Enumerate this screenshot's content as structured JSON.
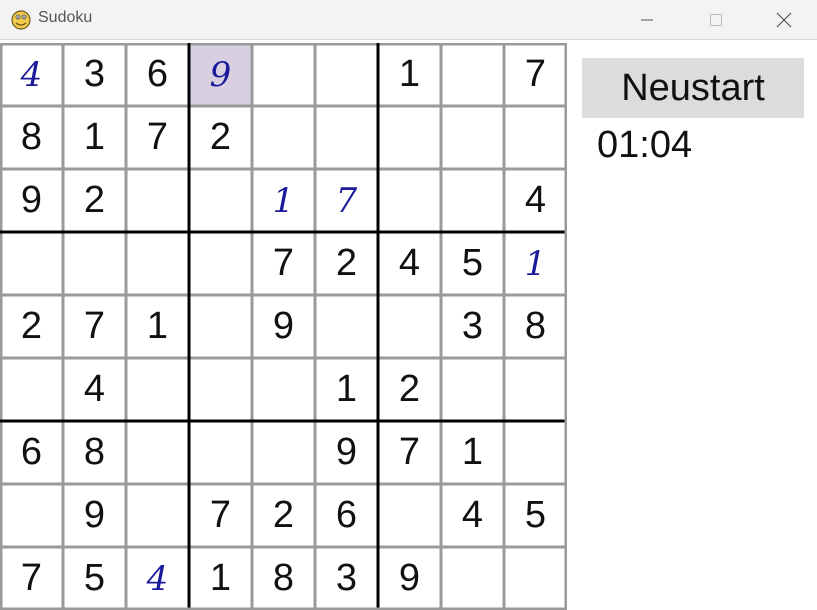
{
  "window": {
    "title": "Sudoku",
    "controls": {
      "minimize_icon": "minimize-icon",
      "maximize_icon": "maximize-icon",
      "close_icon": "close-icon"
    }
  },
  "board": {
    "selected": [
      0,
      3
    ],
    "cells": [
      [
        {
          "v": "4",
          "t": "user"
        },
        {
          "v": "3",
          "t": "given"
        },
        {
          "v": "6",
          "t": "given"
        },
        {
          "v": "9",
          "t": "user"
        },
        {
          "v": "",
          "t": "empty"
        },
        {
          "v": "",
          "t": "empty"
        },
        {
          "v": "1",
          "t": "given"
        },
        {
          "v": "",
          "t": "empty"
        },
        {
          "v": "7",
          "t": "given"
        }
      ],
      [
        {
          "v": "8",
          "t": "given"
        },
        {
          "v": "1",
          "t": "given"
        },
        {
          "v": "7",
          "t": "given"
        },
        {
          "v": "2",
          "t": "given"
        },
        {
          "v": "",
          "t": "empty"
        },
        {
          "v": "",
          "t": "empty"
        },
        {
          "v": "",
          "t": "empty"
        },
        {
          "v": "",
          "t": "empty"
        },
        {
          "v": "",
          "t": "empty"
        }
      ],
      [
        {
          "v": "9",
          "t": "given"
        },
        {
          "v": "2",
          "t": "given"
        },
        {
          "v": "",
          "t": "empty"
        },
        {
          "v": "",
          "t": "empty"
        },
        {
          "v": "1",
          "t": "user"
        },
        {
          "v": "7",
          "t": "user"
        },
        {
          "v": "",
          "t": "empty"
        },
        {
          "v": "",
          "t": "empty"
        },
        {
          "v": "4",
          "t": "given"
        }
      ],
      [
        {
          "v": "",
          "t": "empty"
        },
        {
          "v": "",
          "t": "empty"
        },
        {
          "v": "",
          "t": "empty"
        },
        {
          "v": "",
          "t": "empty"
        },
        {
          "v": "7",
          "t": "given"
        },
        {
          "v": "2",
          "t": "given"
        },
        {
          "v": "4",
          "t": "given"
        },
        {
          "v": "5",
          "t": "given"
        },
        {
          "v": "1",
          "t": "user"
        }
      ],
      [
        {
          "v": "2",
          "t": "given"
        },
        {
          "v": "7",
          "t": "given"
        },
        {
          "v": "1",
          "t": "given"
        },
        {
          "v": "",
          "t": "empty"
        },
        {
          "v": "9",
          "t": "given"
        },
        {
          "v": "",
          "t": "empty"
        },
        {
          "v": "",
          "t": "empty"
        },
        {
          "v": "3",
          "t": "given"
        },
        {
          "v": "8",
          "t": "given"
        }
      ],
      [
        {
          "v": "",
          "t": "empty"
        },
        {
          "v": "4",
          "t": "given"
        },
        {
          "v": "",
          "t": "empty"
        },
        {
          "v": "",
          "t": "empty"
        },
        {
          "v": "",
          "t": "empty"
        },
        {
          "v": "1",
          "t": "given"
        },
        {
          "v": "2",
          "t": "given"
        },
        {
          "v": "",
          "t": "empty"
        },
        {
          "v": "",
          "t": "empty"
        }
      ],
      [
        {
          "v": "6",
          "t": "given"
        },
        {
          "v": "8",
          "t": "given"
        },
        {
          "v": "",
          "t": "empty"
        },
        {
          "v": "",
          "t": "empty"
        },
        {
          "v": "",
          "t": "empty"
        },
        {
          "v": "9",
          "t": "given"
        },
        {
          "v": "7",
          "t": "given"
        },
        {
          "v": "1",
          "t": "given"
        },
        {
          "v": "",
          "t": "empty"
        }
      ],
      [
        {
          "v": "",
          "t": "empty"
        },
        {
          "v": "9",
          "t": "given"
        },
        {
          "v": "",
          "t": "empty"
        },
        {
          "v": "7",
          "t": "given"
        },
        {
          "v": "2",
          "t": "given"
        },
        {
          "v": "6",
          "t": "given"
        },
        {
          "v": "",
          "t": "empty"
        },
        {
          "v": "4",
          "t": "given"
        },
        {
          "v": "5",
          "t": "given"
        }
      ],
      [
        {
          "v": "7",
          "t": "given"
        },
        {
          "v": "5",
          "t": "given"
        },
        {
          "v": "4",
          "t": "user"
        },
        {
          "v": "1",
          "t": "given"
        },
        {
          "v": "8",
          "t": "given"
        },
        {
          "v": "3",
          "t": "given"
        },
        {
          "v": "9",
          "t": "given"
        },
        {
          "v": "",
          "t": "empty"
        },
        {
          "v": "",
          "t": "empty"
        }
      ]
    ]
  },
  "panel": {
    "restart_label": "Neustart",
    "timer": "01:04"
  },
  "colors": {
    "given_digit": "#111111",
    "user_digit": "#1a1a9a",
    "selected_cell": "#d8d0e0",
    "thin_line": "#9a9a9a",
    "thick_line": "#000000",
    "button_bg": "#dcdcdc"
  }
}
